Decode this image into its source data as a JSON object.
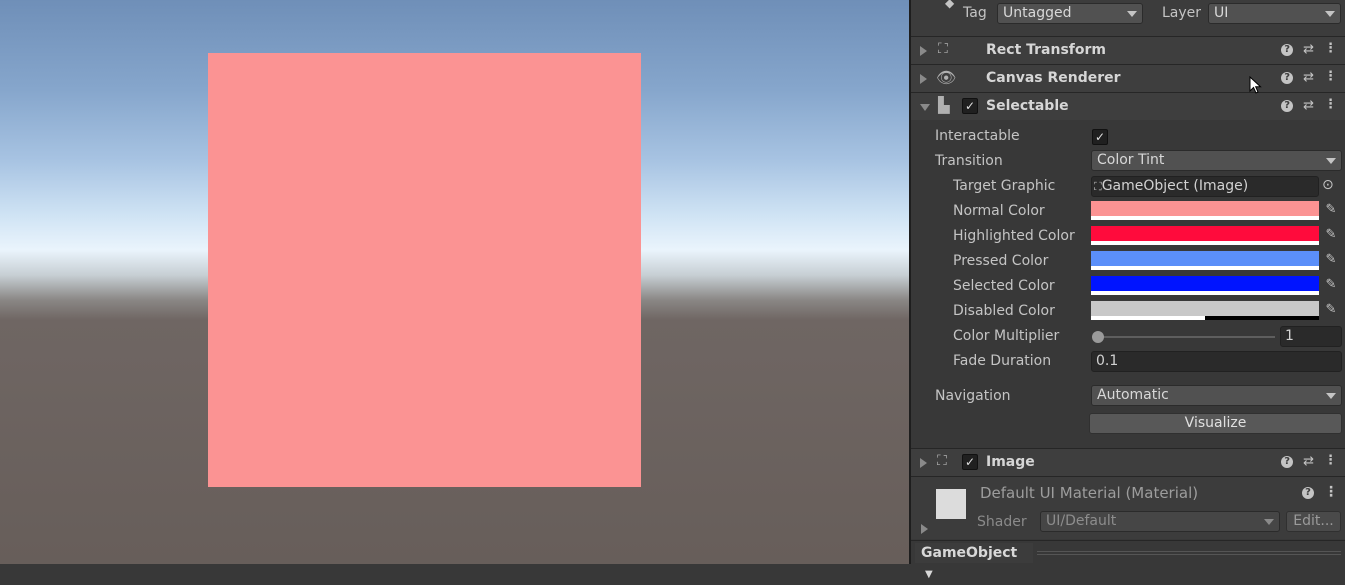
{
  "scene": {
    "square_color": "#fb9393"
  },
  "header": {
    "tag_label": "Tag",
    "tag_value": "Untagged",
    "layer_label": "Layer",
    "layer_value": "UI"
  },
  "components": {
    "rect_transform": "Rect Transform",
    "canvas_renderer": "Canvas Renderer",
    "selectable": "Selectable",
    "image": "Image"
  },
  "selectable": {
    "interactable_label": "Interactable",
    "interactable_checked": true,
    "transition_label": "Transition",
    "transition_value": "Color Tint",
    "target_graphic_label": "Target Graphic",
    "target_graphic_value": "GameObject (Image)",
    "normal_color_label": "Normal Color",
    "highlighted_color_label": "Highlighted Color",
    "pressed_color_label": "Pressed Color",
    "selected_color_label": "Selected Color",
    "disabled_color_label": "Disabled Color",
    "color_multiplier_label": "Color Multiplier",
    "color_multiplier_value": "1",
    "fade_duration_label": "Fade Duration",
    "fade_duration_value": "0.1",
    "navigation_label": "Navigation",
    "navigation_value": "Automatic",
    "visualize_label": "Visualize"
  },
  "colors": {
    "normal": "#fb9393",
    "highlighted": "#ff0b3c",
    "pressed": "#5b8ff9",
    "selected": "#0014ff",
    "disabled": "#c8c8c8",
    "disabled_alpha": 0.5
  },
  "material": {
    "name": "Default UI Material (Material)",
    "shader_label": "Shader",
    "shader_value": "UI/Default",
    "edit_label": "Edit..."
  },
  "footer": {
    "gameobject_label": "GameObject"
  }
}
